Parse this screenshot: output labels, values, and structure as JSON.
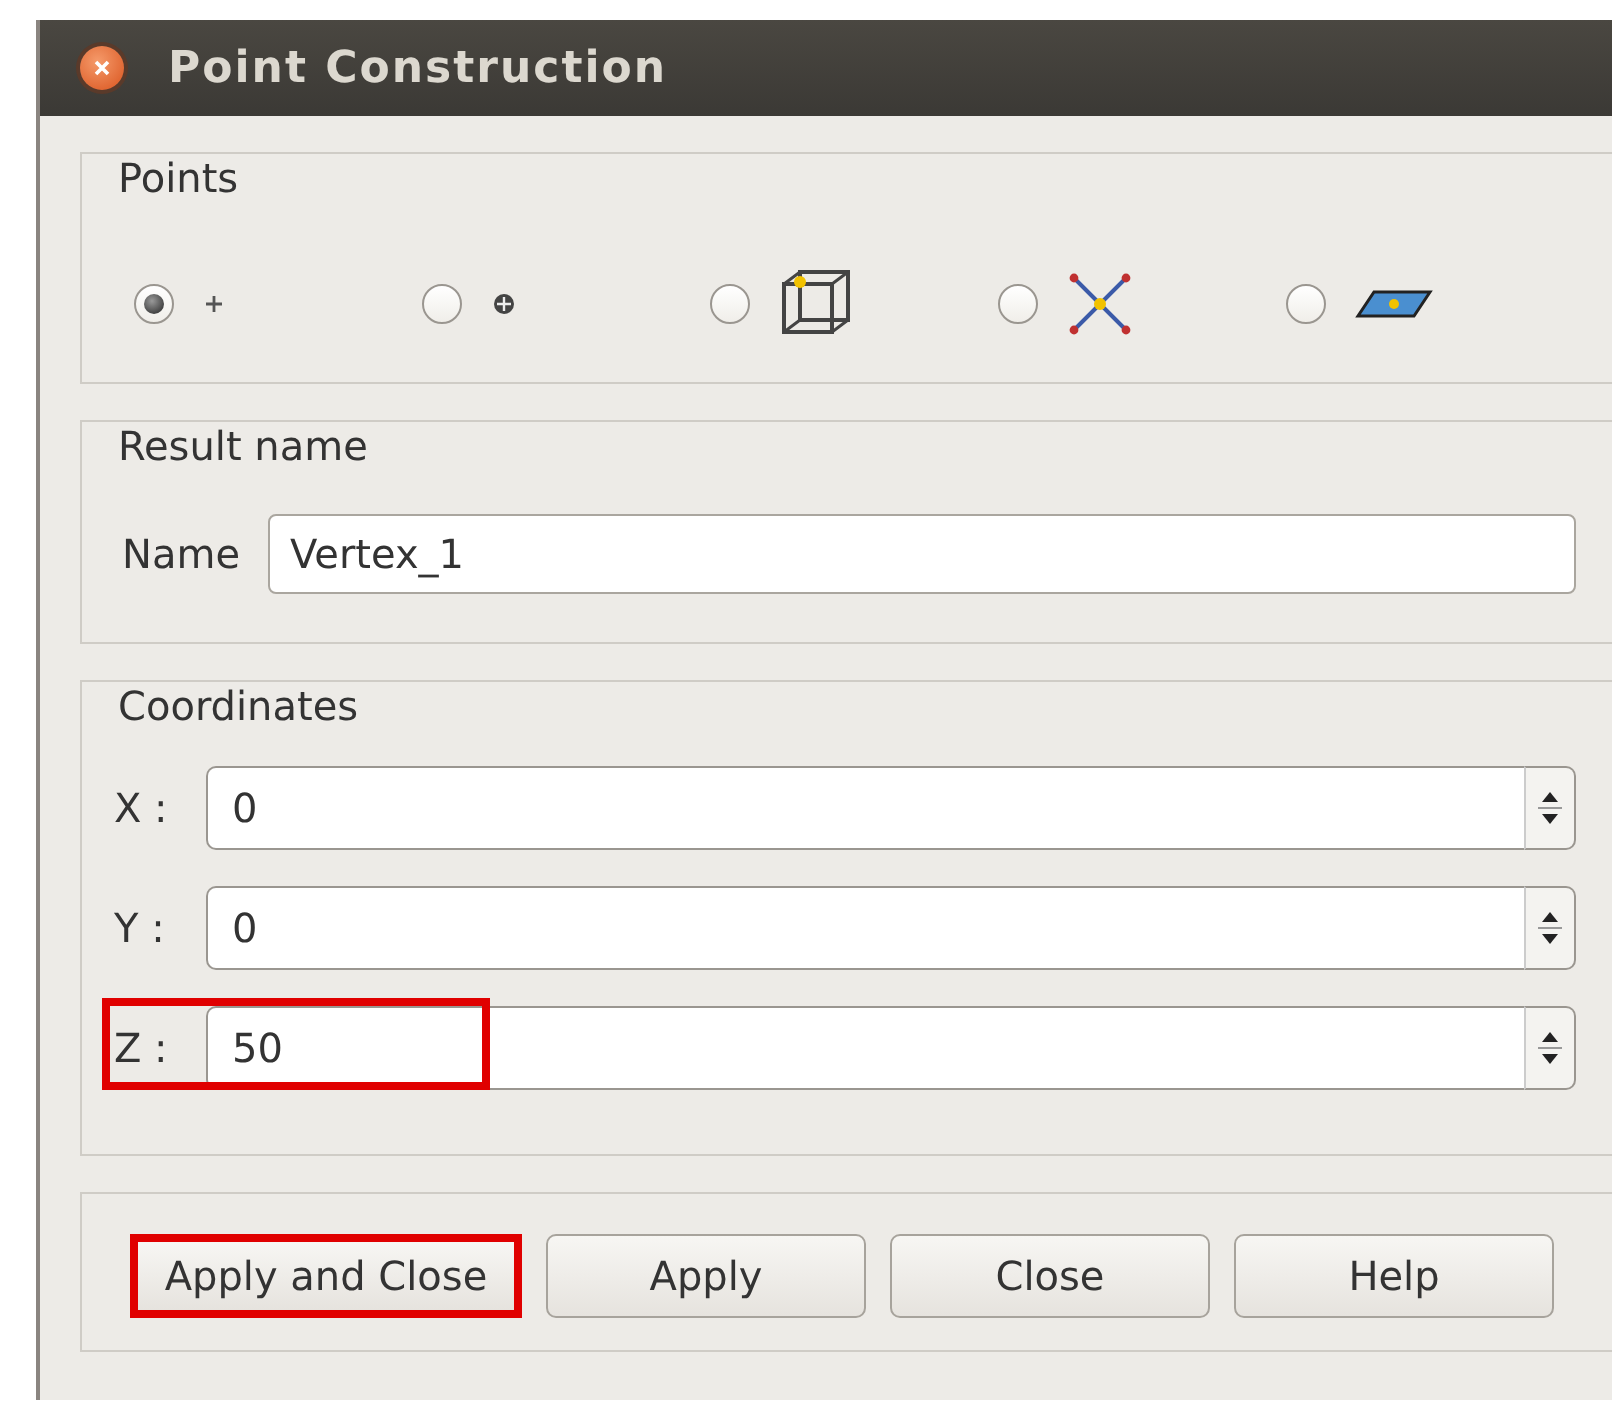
{
  "window": {
    "title": "Point Construction"
  },
  "points": {
    "title": "Points",
    "options": [
      {
        "kind": "plus",
        "selected": true
      },
      {
        "kind": "circle-plus",
        "selected": false
      },
      {
        "kind": "cube",
        "selected": false
      },
      {
        "kind": "cross-lines",
        "selected": false
      },
      {
        "kind": "plane",
        "selected": false
      }
    ]
  },
  "result_name": {
    "title": "Result name",
    "label": "Name",
    "value": "Vertex_1"
  },
  "coordinates": {
    "title": "Coordinates",
    "fields": [
      {
        "label": "X :",
        "value": "0",
        "highlighted": false
      },
      {
        "label": "Y :",
        "value": "0",
        "highlighted": false
      },
      {
        "label": "Z :",
        "value": "50",
        "highlighted": true
      }
    ]
  },
  "buttons": [
    {
      "label": "Apply and Close",
      "highlighted": true
    },
    {
      "label": "Apply",
      "highlighted": false
    },
    {
      "label": "Close",
      "highlighted": false
    },
    {
      "label": "Help",
      "highlighted": false
    }
  ]
}
